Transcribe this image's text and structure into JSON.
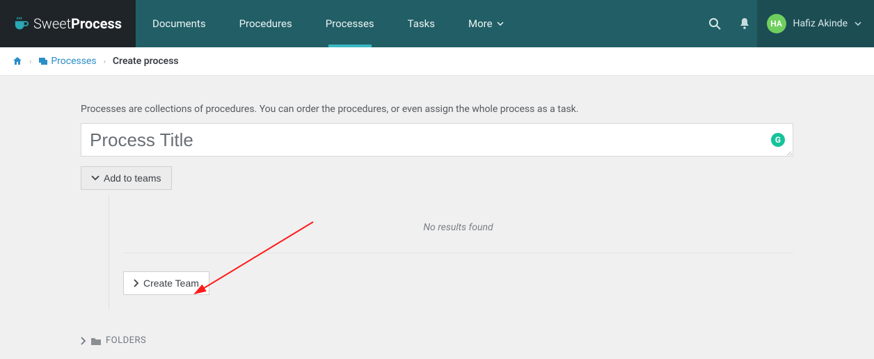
{
  "brand": {
    "text_light": "Sweet",
    "text_bold": "Process"
  },
  "nav": {
    "documents": "Documents",
    "procedures": "Procedures",
    "processes": "Processes",
    "tasks": "Tasks",
    "more": "More"
  },
  "user": {
    "initials": "HA",
    "name": "Hafiz Akinde"
  },
  "breadcrumb": {
    "processes": "Processes",
    "current": "Create process"
  },
  "hint": "Processes are collections of procedures. You can order the procedures, or even assign the whole process as a task.",
  "title_placeholder": "Process Title",
  "add_teams_label": "Add to teams",
  "no_results": "No results found",
  "create_team_label": "Create Team",
  "folders_label": "FOLDERS",
  "grammarly": "G"
}
